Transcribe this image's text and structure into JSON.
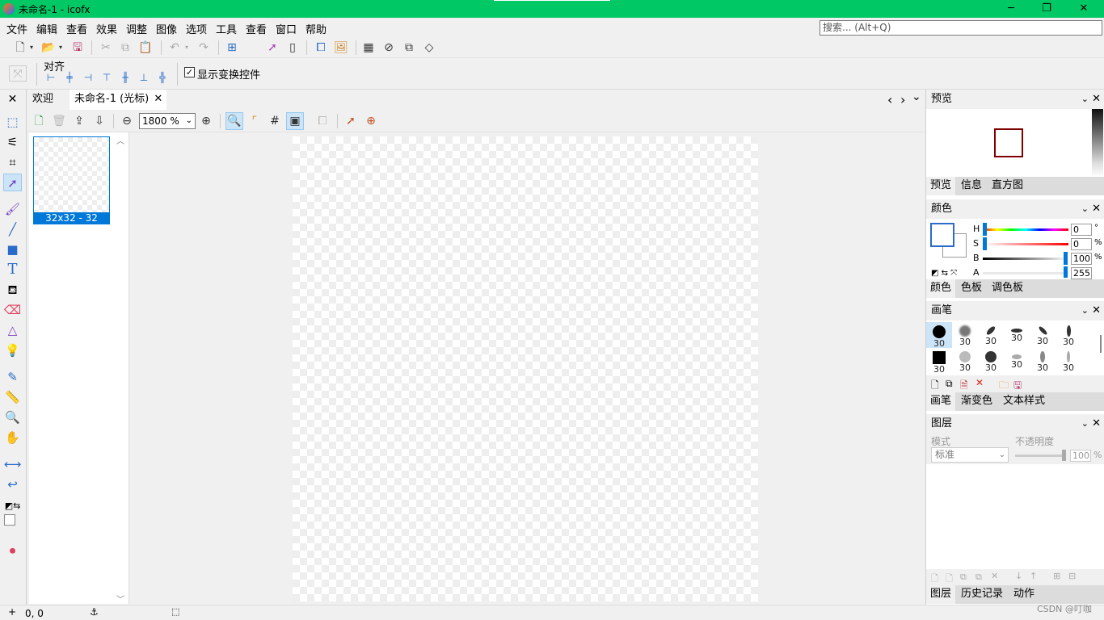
{
  "window": {
    "title": "未命名-1 - icofx",
    "minimize": "─",
    "restore": "❐",
    "close": "✕"
  },
  "menu": [
    "文件",
    "编辑",
    "查看",
    "效果",
    "调整",
    "图像",
    "选项",
    "工具",
    "查看",
    "窗口",
    "帮助"
  ],
  "search": {
    "placeholder": "搜索... (Alt+Q)"
  },
  "align": {
    "label": "对齐",
    "show_transform": "显示变换控件",
    "show_transform_checked": true
  },
  "tabs": [
    {
      "label": "欢迎"
    },
    {
      "label": "未命名-1 (光标)"
    }
  ],
  "tab_nav": {
    "prev": "‹",
    "next": "›",
    "menu": "⌄"
  },
  "zoom": {
    "value": "1800 %"
  },
  "thumbnail": {
    "label": "32x32 - 32"
  },
  "preview_panel": {
    "title": "预览",
    "tabs": [
      "预览",
      "信息",
      "直方图"
    ]
  },
  "color_panel": {
    "title": "颜色",
    "channels": [
      {
        "label": "H",
        "value": "0",
        "unit": "°"
      },
      {
        "label": "S",
        "value": "0",
        "unit": "%"
      },
      {
        "label": "B",
        "value": "100",
        "unit": "%"
      },
      {
        "label": "A",
        "value": "255",
        "unit": ""
      }
    ],
    "tabs": [
      "颜色",
      "色板",
      "调色板"
    ]
  },
  "brush_panel": {
    "title": "画笔",
    "brush_sizes": [
      "30",
      "30",
      "30",
      "30",
      "30",
      "30",
      "30",
      "30",
      "30",
      "30",
      "30",
      "30"
    ],
    "tabs": [
      "画笔",
      "渐变色",
      "文本样式"
    ]
  },
  "layers_panel": {
    "title": "图层",
    "mode_label": "模式",
    "mode_value": "标准",
    "opacity_label": "不透明度",
    "opacity_value": "100",
    "opacity_unit": "%",
    "tabs": [
      "图层",
      "历史记录",
      "动作"
    ]
  },
  "status": {
    "coords": "0, 0",
    "watermark": "CSDN @叮咖"
  },
  "colors": {
    "titlebar": "#00c864",
    "selection": "#0078d7",
    "preview_square": "#800000"
  }
}
